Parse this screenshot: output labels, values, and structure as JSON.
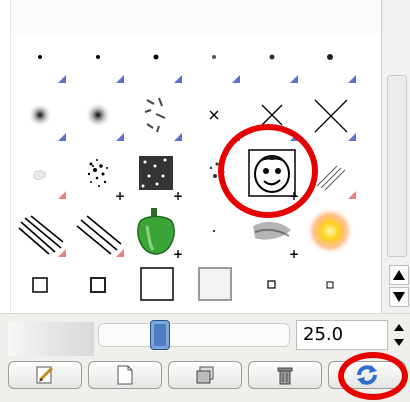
{
  "panel": {
    "title": "",
    "spacing_value": "25.0"
  },
  "brushes": {
    "rows": [
      [
        "small-dot",
        "small-dot",
        "small-dot",
        "small-dot",
        "small-dot",
        "small-dot"
      ],
      [
        "blur-dot",
        "blur-dot",
        "scatter",
        "x-small",
        "x-medium",
        "x-large"
      ],
      [
        "smudge",
        "spray-a",
        "spray-b",
        "spray-c",
        "face",
        "hatch"
      ],
      [
        "lines-a",
        "lines-b",
        "pepper",
        "dot",
        "brush-stroke",
        "sun"
      ],
      [
        "square-sm",
        "square-sm2",
        "square-lg",
        "square-fuzzy",
        "square-tiny",
        "square-tiny2"
      ]
    ]
  },
  "toolbar": {
    "buttons": [
      "edit-brush",
      "new-brush",
      "duplicate-brush",
      "delete-brush",
      "refresh-brushes"
    ]
  },
  "annotation": {
    "color": "#e60000"
  }
}
